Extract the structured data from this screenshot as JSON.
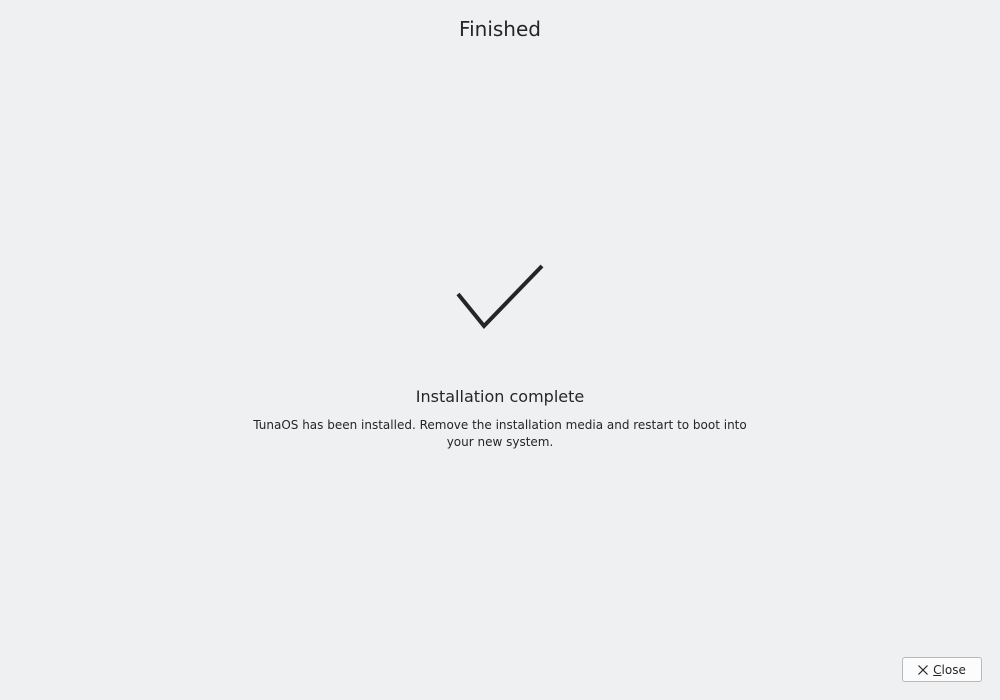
{
  "header": {
    "title": "Finished"
  },
  "main": {
    "status_icon": "checkmark-icon",
    "heading": "Installation complete",
    "message": "TunaOS has been installed. Remove the installation media and restart to boot into your new system."
  },
  "footer": {
    "close_label": "Close",
    "close_icon": "close-icon"
  },
  "colors": {
    "background": "#eff0f1",
    "text": "#232629",
    "button_border": "#b7babd"
  }
}
